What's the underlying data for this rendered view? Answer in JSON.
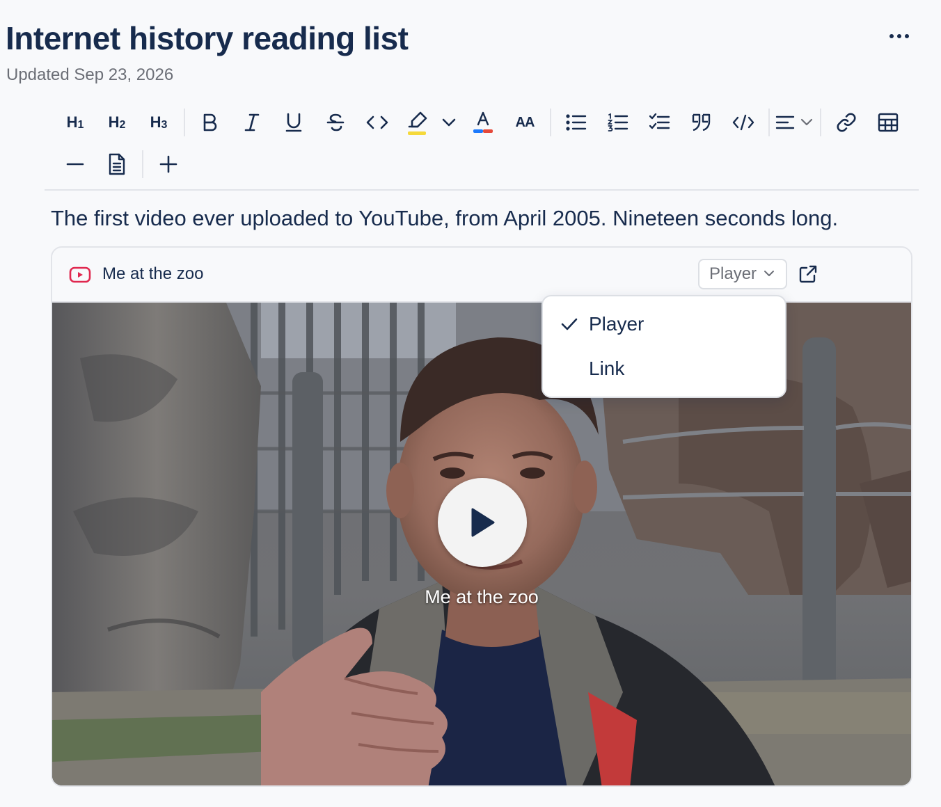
{
  "page": {
    "title": "Internet history reading list",
    "meta": "Updated Sep 23, 2026"
  },
  "toolbar": {
    "h1_label": "H",
    "h1_num": "1",
    "h2_label": "H",
    "h2_num": "2",
    "h3_label": "H",
    "h3_num": "3",
    "text_size_label": "AA"
  },
  "content": {
    "paragraph": "The first video ever uploaded to YouTube, from April 2005. Nineteen seconds long."
  },
  "embed": {
    "title": "Me at the zoo",
    "display_mode_selected": "Player",
    "video_caption": "Me at the zoo",
    "options": [
      {
        "label": "Player",
        "selected": true
      },
      {
        "label": "Link",
        "selected": false
      }
    ]
  },
  "colors": {
    "text": "#172b4d",
    "youtube_red": "#e0284f",
    "highlight_yellow": "#f5d93b",
    "text_color_red": "#e5493a",
    "text_color_blue": "#1d7afc"
  }
}
